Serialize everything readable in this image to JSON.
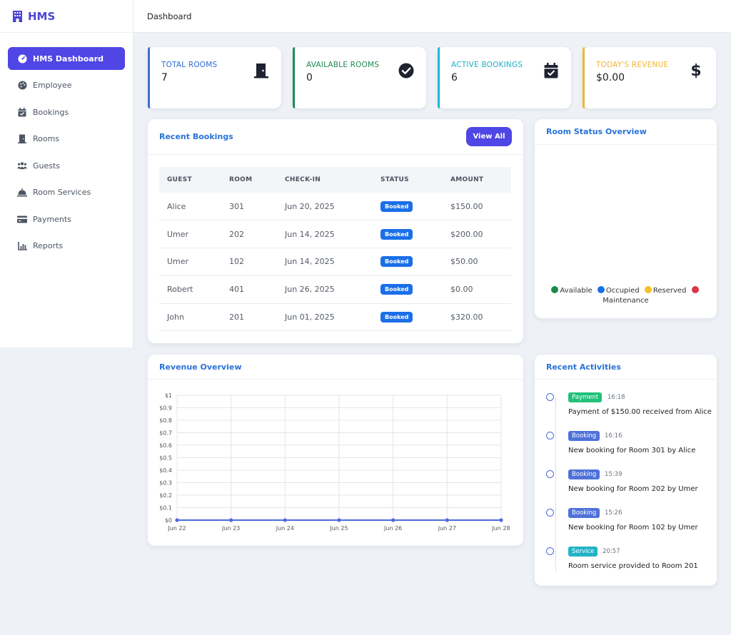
{
  "brand": {
    "name": "HMS"
  },
  "sidebar": {
    "items": [
      {
        "label": "HMS Dashboard",
        "icon": "gauge-icon",
        "active": true
      },
      {
        "label": "Employee",
        "icon": "palette-icon"
      },
      {
        "label": "Bookings",
        "icon": "calendar-check-icon"
      },
      {
        "label": "Rooms",
        "icon": "door-icon"
      },
      {
        "label": "Guests",
        "icon": "users-icon"
      },
      {
        "label": "Room Services",
        "icon": "bell-service-icon"
      },
      {
        "label": "Payments",
        "icon": "credit-card-icon"
      },
      {
        "label": "Reports",
        "icon": "chart-icon"
      }
    ]
  },
  "topbar": {
    "title": "Dashboard"
  },
  "stats": [
    {
      "label": "TOTAL ROOMS",
      "value": "7",
      "color": "#3d6fd6",
      "icon": "door-icon"
    },
    {
      "label": "AVAILABLE ROOMS",
      "value": "0",
      "color": "#1f8a56",
      "icon": "check-circle-icon"
    },
    {
      "label": "ACTIVE BOOKINGS",
      "value": "6",
      "color": "#1fb8cc",
      "icon": "calendar-check-icon"
    },
    {
      "label": "TODAY'S REVENUE",
      "value": "$0.00",
      "color": "#f2b632",
      "icon": "dollar-icon"
    }
  ],
  "recent_bookings": {
    "title": "Recent Bookings",
    "view_all": "View All",
    "columns": [
      "GUEST",
      "ROOM",
      "CHECK-IN",
      "STATUS",
      "AMOUNT"
    ],
    "rows": [
      {
        "guest": "Alice",
        "room": "301",
        "checkin": "Jun 20, 2025",
        "status": "Booked",
        "amount": "$150.00"
      },
      {
        "guest": "Umer",
        "room": "202",
        "checkin": "Jun 14, 2025",
        "status": "Booked",
        "amount": "$200.00"
      },
      {
        "guest": "Umer",
        "room": "102",
        "checkin": "Jun 14, 2025",
        "status": "Booked",
        "amount": "$50.00"
      },
      {
        "guest": "Robert",
        "room": "401",
        "checkin": "Jun 26, 2025",
        "status": "Booked",
        "amount": "$0.00"
      },
      {
        "guest": "John",
        "room": "201",
        "checkin": "Jun 01, 2025",
        "status": "Booked",
        "amount": "$320.00"
      }
    ]
  },
  "room_status": {
    "title": "Room Status Overview",
    "legend": [
      {
        "label": "Available",
        "color": "#1e8a4c"
      },
      {
        "label": "Occupied",
        "color": "#1a6fe8"
      },
      {
        "label": "Reserved",
        "color": "#f5bf26"
      },
      {
        "label": "Maintenance",
        "color": "#dc3545"
      }
    ]
  },
  "revenue": {
    "title": "Revenue Overview"
  },
  "chart_data": {
    "type": "line",
    "title": "Revenue Overview",
    "x": [
      "Jun 22",
      "Jun 23",
      "Jun 24",
      "Jun 25",
      "Jun 26",
      "Jun 27",
      "Jun 28"
    ],
    "values": [
      0,
      0,
      0,
      0,
      0,
      0,
      0
    ],
    "yticks": [
      "$0",
      "$0.1",
      "$0.2",
      "$0.3",
      "$0.4",
      "$0.5",
      "$0.6",
      "$0.7",
      "$0.8",
      "$0.9",
      "$1"
    ],
    "ylim": [
      0,
      1
    ],
    "grid": true,
    "color": "#4f6bd8"
  },
  "activities": {
    "title": "Recent Activities",
    "items": [
      {
        "tag": "Payment",
        "tag_color": "#22c07a",
        "time": "16:18",
        "text": "Payment of $150.00 received from Alice"
      },
      {
        "tag": "Booking",
        "tag_color": "#4f72d8",
        "time": "16:16",
        "text": "New booking for Room 301 by Alice"
      },
      {
        "tag": "Booking",
        "tag_color": "#4f72d8",
        "time": "15:39",
        "text": "New booking for Room 202 by Umer"
      },
      {
        "tag": "Booking",
        "tag_color": "#4f72d8",
        "time": "15:26",
        "text": "New booking for Room 102 by Umer"
      },
      {
        "tag": "Service",
        "tag_color": "#22b3c8",
        "time": "20:57",
        "text": "Room service provided to Room 201"
      }
    ]
  }
}
